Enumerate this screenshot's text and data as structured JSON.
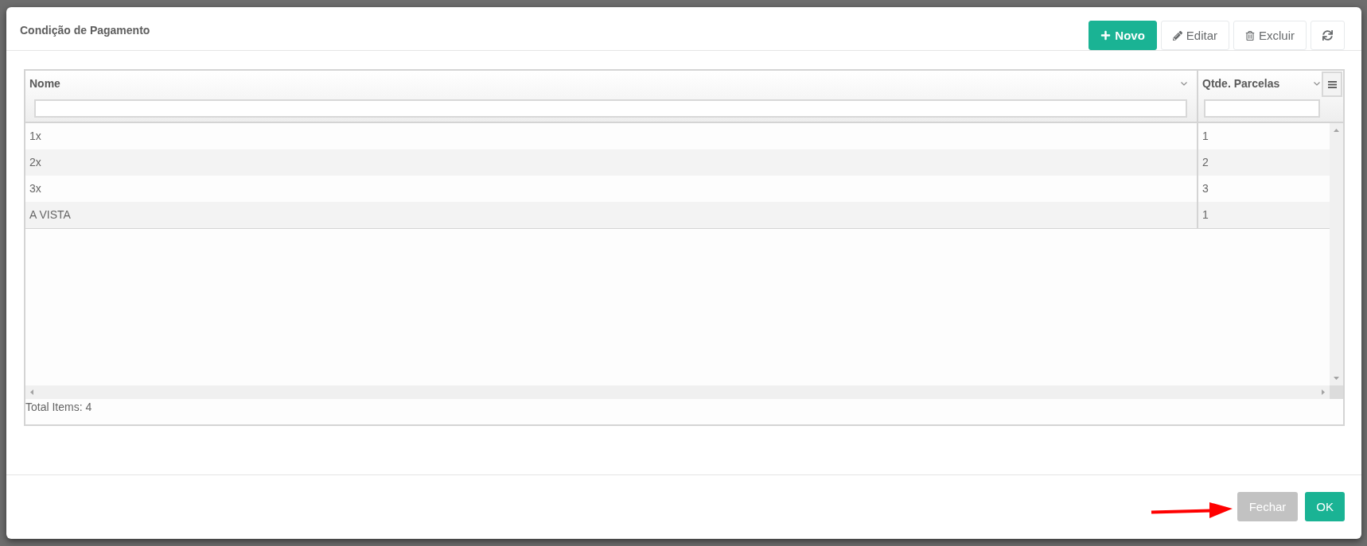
{
  "dialog": {
    "title": "Condição de Pagamento"
  },
  "toolbar": [
    {
      "kind": "add",
      "label": "Novo"
    },
    {
      "kind": "edit",
      "label": "Editar"
    },
    {
      "kind": "delete",
      "label": "Excluir"
    },
    {
      "kind": "refresh"
    }
  ],
  "grid": {
    "columns": [
      {
        "title": "Nome"
      },
      {
        "title": "Qtde. Parcelas"
      }
    ],
    "rows": [
      {
        "cells": [
          "1x",
          "1"
        ],
        "selected": false
      },
      {
        "cells": [
          "2x",
          "2"
        ],
        "selected": false
      },
      {
        "cells": [
          "3x",
          "3"
        ],
        "selected": false
      },
      {
        "cells": [
          "A VISTA",
          "1"
        ],
        "selected": false
      }
    ],
    "footer_text": "Total Items: 4"
  },
  "footer_buttons": [
    {
      "kind": "secondary",
      "label": "Fechar"
    },
    {
      "kind": "primary",
      "label": "OK"
    }
  ]
}
